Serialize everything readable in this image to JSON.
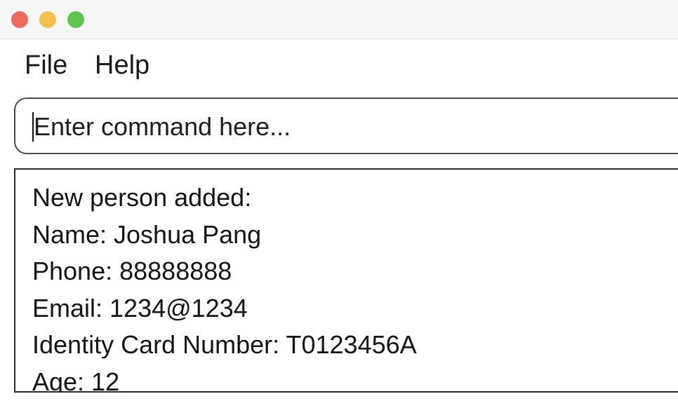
{
  "window": {
    "controls": {
      "close_color": "#ed6a5e",
      "minimize_color": "#f5bf4f",
      "zoom_color": "#61c554"
    }
  },
  "menubar": {
    "items": [
      {
        "label": "File"
      },
      {
        "label": "Help"
      }
    ]
  },
  "command": {
    "placeholder": "Enter command here...",
    "value": ""
  },
  "result": {
    "lines": [
      "New person added:",
      "Name: Joshua Pang",
      "Phone: 88888888",
      "Email: 1234@1234",
      "Identity Card Number: T0123456A",
      "Age: 12"
    ]
  }
}
